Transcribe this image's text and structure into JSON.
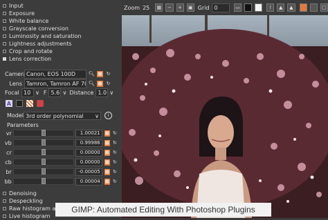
{
  "modules_top": [
    "Input",
    "Exposure",
    "White balance",
    "Grayscale conversion",
    "Luminosity and saturation",
    "Lightness adjustments",
    "Crop and rotate",
    "Lens correction"
  ],
  "lens": {
    "camera_label": "Camera",
    "camera_value": "Canon, EOS 100D",
    "lens_label": "Lens",
    "lens_value": "Tamron, Tamron AF 70-",
    "focal_label": "Focal",
    "focal_value": "10",
    "f_label": "F",
    "f_value": "5.6",
    "distance_label": "Distance",
    "distance_value": "1.0",
    "model_label": "Model",
    "model_value": "3rd order polynomial",
    "params_title": "Parameters",
    "params": [
      {
        "label": "vr",
        "value": "1.00021",
        "level": 0.5
      },
      {
        "label": "vb",
        "value": "0.99986",
        "level": 0.5
      },
      {
        "label": "cr",
        "value": "0.00000",
        "level": 0.5
      },
      {
        "label": "cb",
        "value": "0.00000",
        "level": 0.5
      },
      {
        "label": "br",
        "value": "-0.00005",
        "level": 0.5
      },
      {
        "label": "bb",
        "value": "0.00004",
        "level": 0.5
      }
    ]
  },
  "modules_bottom": [
    "Denoising",
    "Despeckling",
    "Raw histogram and",
    "Live histogram"
  ],
  "toolbar": {
    "zoom_label": "Zoom",
    "zoom_value": "25",
    "grid_label": "Grid",
    "grid_value": "0"
  },
  "caption": "GIMP: Automated Editing With Photoshop Plugins",
  "colors": {
    "panel": "#3c3c3c",
    "accent": "#e07b3c",
    "caption_bg": "#f1f1f1"
  }
}
